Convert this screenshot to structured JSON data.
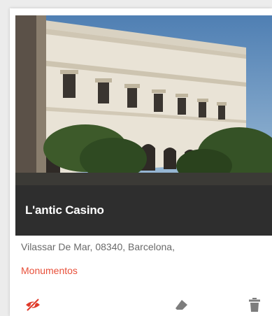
{
  "card": {
    "title": "L'antic Casino",
    "address": "Vilassar De Mar, 08340, Barcelona,",
    "category": "Monumentos",
    "photo_alt": "L'antic Casino building photo"
  },
  "actions": {
    "visibility_icon": "eye-slash-icon",
    "edit_icon": "eraser-icon",
    "delete_icon": "trash-icon"
  },
  "colors": {
    "title_bar": "#2e2e2e",
    "category_link": "#e8503a",
    "visibility_icon": "#e03a2a",
    "action_icons": "#7d7d7d"
  }
}
